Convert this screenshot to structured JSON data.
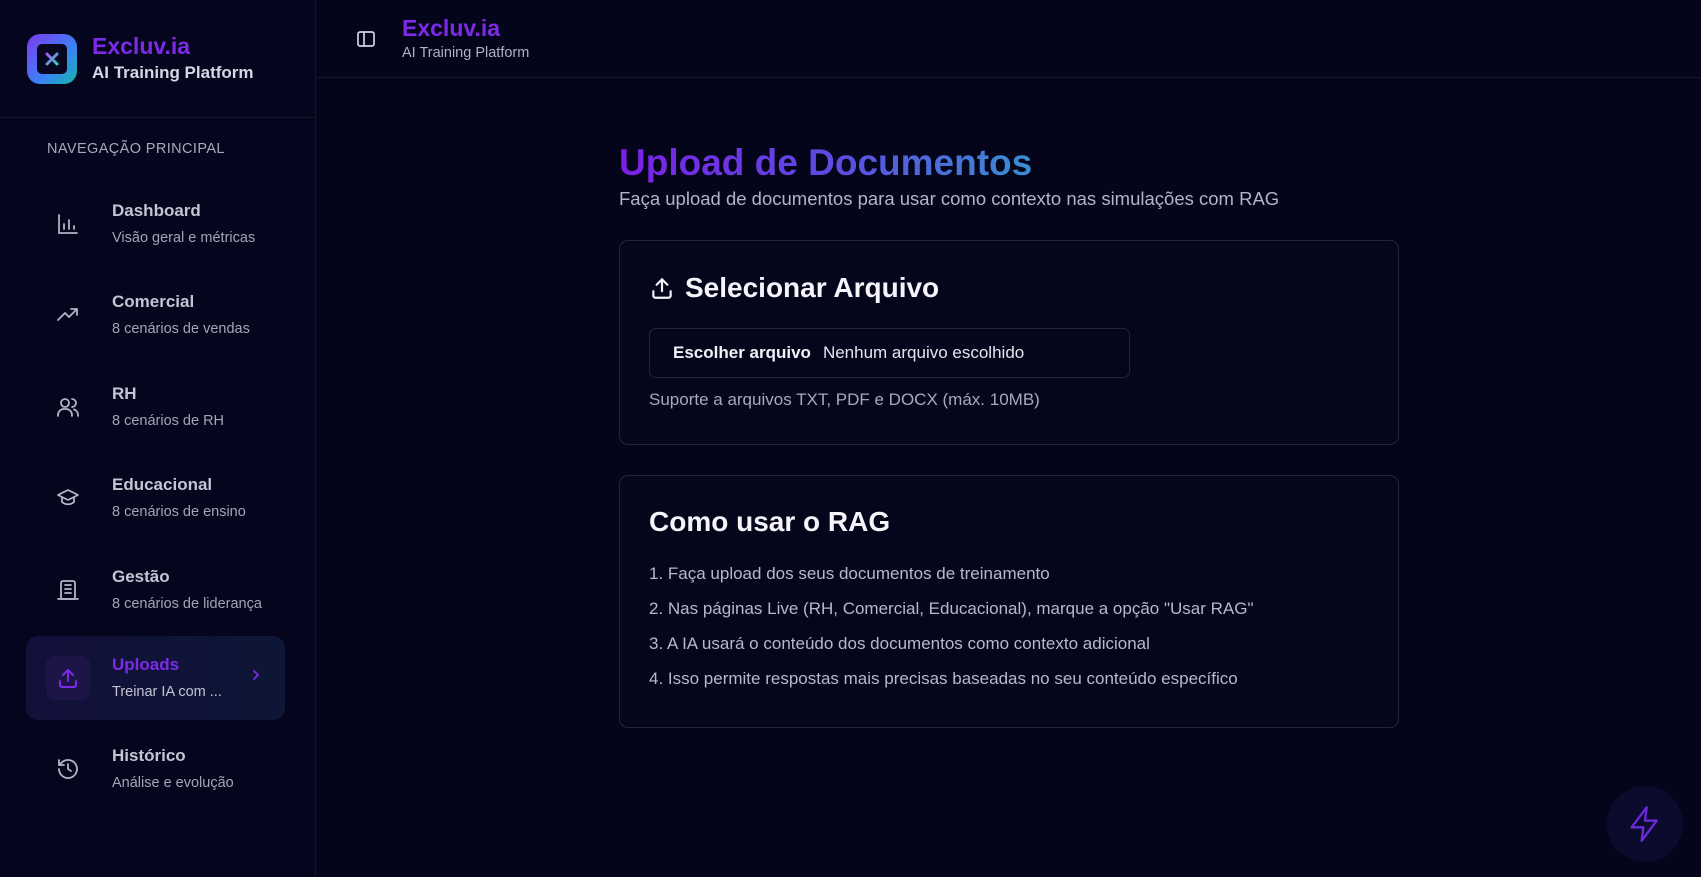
{
  "brand": {
    "name": "Excluv.ia",
    "subtitle": "AI Training Platform"
  },
  "nav": {
    "heading": "NAVEGAÇÃO PRINCIPAL",
    "items": [
      {
        "title": "Dashboard",
        "desc": "Visão geral e métricas",
        "icon": "bar-chart-icon"
      },
      {
        "title": "Comercial",
        "desc": "8 cenários de vendas",
        "icon": "trending-up-icon"
      },
      {
        "title": "RH",
        "desc": "8 cenários de RH",
        "icon": "users-icon"
      },
      {
        "title": "Educacional",
        "desc": "8 cenários de ensino",
        "icon": "graduation-cap-icon"
      },
      {
        "title": "Gestão",
        "desc": "8 cenários de liderança",
        "icon": "building-icon"
      },
      {
        "title": "Uploads",
        "desc": "Treinar IA com ...",
        "icon": "upload-icon",
        "active": true
      },
      {
        "title": "Histórico",
        "desc": "Análise e evolução",
        "icon": "history-icon"
      }
    ]
  },
  "header": {
    "title": "Excluv.ia",
    "subtitle": "AI Training Platform"
  },
  "page": {
    "title": "Upload de Documentos",
    "subtitle": "Faça upload de documentos para usar como contexto nas simulações com RAG"
  },
  "upload_card": {
    "title": "Selecionar Arquivo",
    "choose_label": "Escolher arquivo",
    "no_file": "Nenhum arquivo escolhido",
    "support": "Suporte a arquivos TXT, PDF e DOCX (máx. 10MB)"
  },
  "rag_card": {
    "title": "Como usar o RAG",
    "steps": [
      "1. Faça upload dos seus documentos de treinamento",
      "2. Nas páginas Live (RH, Comercial, Educacional), marque a opção \"Usar RAG\"",
      "3. A IA usará o conteúdo dos documentos como contexto adicional",
      "4. Isso permite respostas mais precisas baseadas no seu conteúdo específico"
    ]
  },
  "colors": {
    "accent": "#7c2ae8",
    "background": "#04041a"
  }
}
